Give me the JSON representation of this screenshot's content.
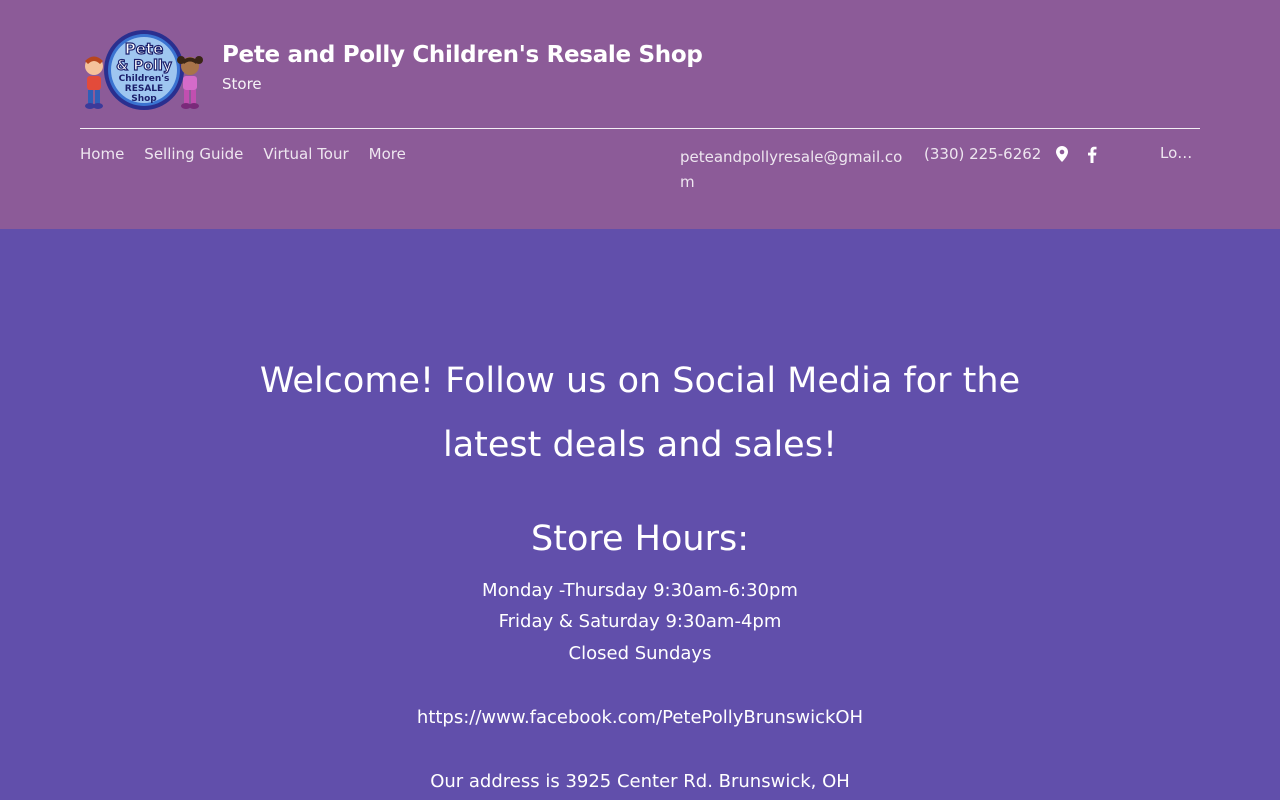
{
  "header": {
    "title": "Pete and Polly Children's Resale Shop",
    "subtitle": "Store",
    "logo": {
      "line1": "Pete",
      "line2": "& Polly",
      "line3": "Children's",
      "line4": "RESALE",
      "line5": "Shop"
    }
  },
  "nav": {
    "items": [
      {
        "label": "Home"
      },
      {
        "label": "Selling Guide"
      },
      {
        "label": "Virtual Tour"
      },
      {
        "label": "More"
      }
    ]
  },
  "contact": {
    "email": "peteandpollyresale@gmail.com",
    "phone": "(330) 225-6262"
  },
  "social": {
    "icons": [
      "map-pin-icon",
      "facebook-icon"
    ]
  },
  "login": {
    "label": "Log In"
  },
  "main": {
    "welcome": "Welcome! Follow us on Social Media for the latest deals and sales!",
    "hours_title": "Store Hours:",
    "hours": [
      "Monday -Thursday  9:30am-6:30pm",
      "Friday & Saturday 9:30am-4pm",
      "Closed Sundays"
    ],
    "facebook_url": "https://www.facebook.com/PetePollyBrunswickOH",
    "address": "Our address is 3925 Center Rd. Brunswick, OH"
  },
  "colors": {
    "header_bg": "#8c5b98",
    "main_bg": "#614fab",
    "text": "#ffffff"
  }
}
